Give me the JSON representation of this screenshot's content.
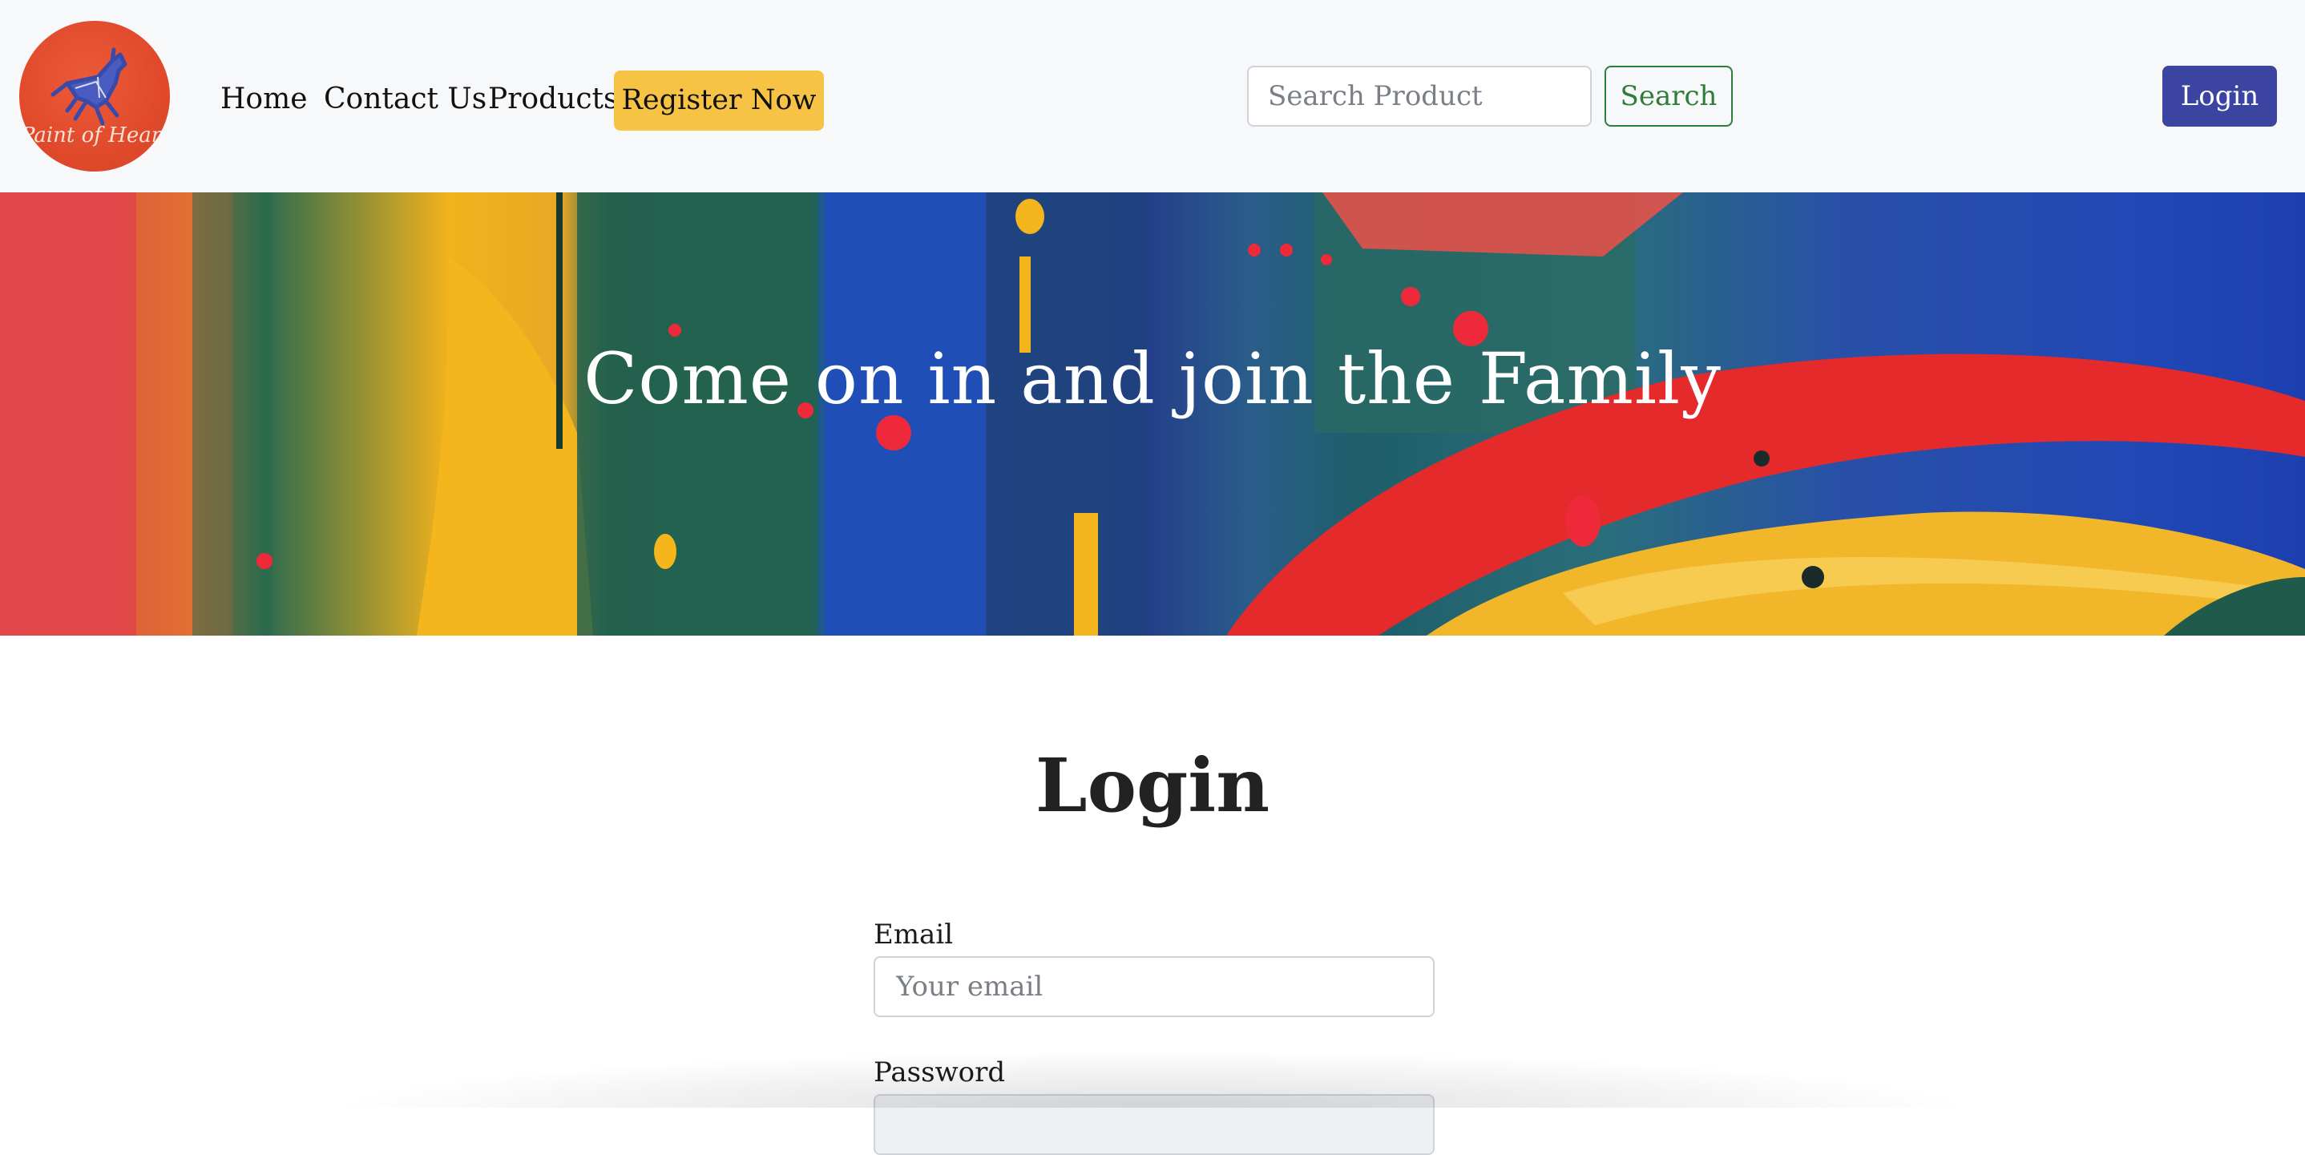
{
  "navbar": {
    "logo_text": "Paint of Hearts",
    "links": [
      {
        "label": "Home"
      },
      {
        "label": "Contact Us"
      },
      {
        "label": "Products"
      }
    ],
    "register_label": "Register Now",
    "search": {
      "placeholder": "Search Product",
      "button_label": "Search"
    },
    "login_label": "Login"
  },
  "hero": {
    "title": "Come on in and join the Family"
  },
  "login_form": {
    "title": "Login",
    "email": {
      "label": "Email",
      "placeholder": "Your email"
    },
    "password": {
      "label": "Password"
    }
  },
  "colors": {
    "register_button": "#f6c344",
    "search_button_text": "#2e7d3a",
    "login_button": "#3b44a0",
    "logo_background": "#e04a2a",
    "navbar_background": "#f7f8fa"
  },
  "icons": {
    "logo": "horse-logo-icon"
  }
}
